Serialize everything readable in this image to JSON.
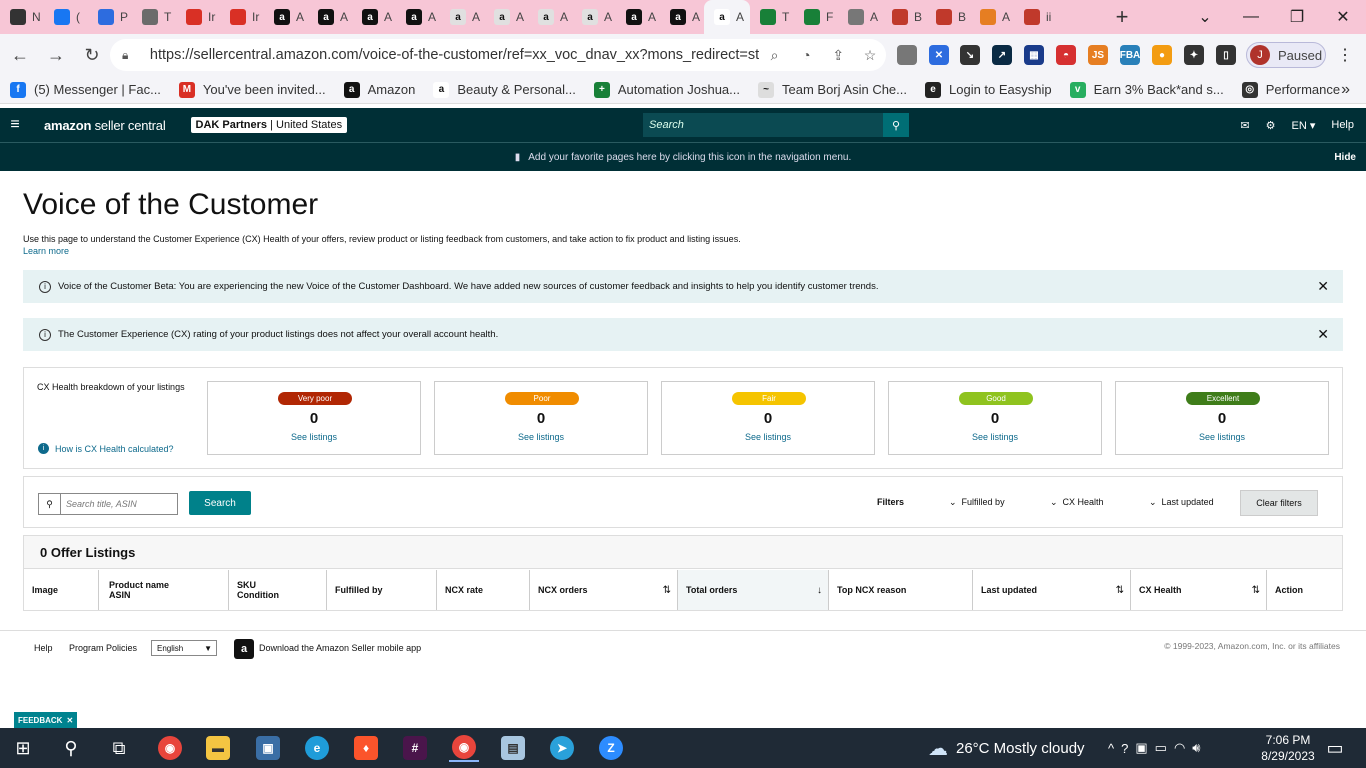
{
  "browser": {
    "tabs": [
      {
        "label": "N",
        "icon": "github-icon",
        "color": "#333333"
      },
      {
        "label": "(",
        "icon": "facebook-icon",
        "color": "#1877f2"
      },
      {
        "label": "P",
        "icon": "zoho-icon",
        "color": "#2d6cdf"
      },
      {
        "label": "T",
        "icon": "t-icon",
        "color": "#6b6b6b"
      },
      {
        "label": "Ir",
        "icon": "gmail-icon",
        "color": "#d93025"
      },
      {
        "label": "Ir",
        "icon": "gmail-icon",
        "color": "#d93025"
      },
      {
        "label": "A",
        "icon": "amazon-icon",
        "color": "#111111"
      },
      {
        "label": "A",
        "icon": "amazon-icon",
        "color": "#111111"
      },
      {
        "label": "A",
        "icon": "amazon-icon",
        "color": "#111111"
      },
      {
        "label": "A",
        "icon": "amazon-icon",
        "color": "#111111"
      },
      {
        "label": "A",
        "icon": "amazon-smile-icon",
        "color": "#e0e0e0"
      },
      {
        "label": "A",
        "icon": "amazon-smile-icon",
        "color": "#e0e0e0"
      },
      {
        "label": "A",
        "icon": "amazon-smile-icon",
        "color": "#e0e0e0"
      },
      {
        "label": "A",
        "icon": "amazon-smile-icon",
        "color": "#e0e0e0"
      },
      {
        "label": "A",
        "icon": "amazon-icon",
        "color": "#111111"
      },
      {
        "label": "A",
        "icon": "amazon-icon",
        "color": "#111111"
      },
      {
        "label": "A",
        "icon": "amazon-seller-icon",
        "color": "#ffffff",
        "active": true
      },
      {
        "label": "T",
        "icon": "sheets-icon",
        "color": "#188038"
      },
      {
        "label": "F",
        "icon": "sheets-icon",
        "color": "#188038"
      },
      {
        "label": "A",
        "icon": "globe-icon",
        "color": "#777777"
      },
      {
        "label": "B",
        "icon": "helium-icon",
        "color": "#c0392b"
      },
      {
        "label": "B",
        "icon": "helium-icon",
        "color": "#c0392b"
      },
      {
        "label": "A",
        "icon": "pencil-icon",
        "color": "#e67e22"
      },
      {
        "label": "ii",
        "icon": "v-icon",
        "color": "#c0392b"
      }
    ],
    "url": "https://sellercentral.amazon.com/voice-of-the-customer/ref=xx_voc_dnav_xx?mons_redirect=stck...",
    "profile_initial": "J",
    "profile_status": "Paused",
    "extensions": [
      {
        "icon": "disk-icon",
        "color": "#777777",
        "text": ""
      },
      {
        "icon": "x-ext-icon",
        "color": "#2d6cdf",
        "text": "✕"
      },
      {
        "icon": "cursor-icon",
        "color": "#333333",
        "text": "↘"
      },
      {
        "icon": "chart-ext-icon",
        "color": "#0a2a44",
        "text": "↗"
      },
      {
        "icon": "grid-ext-icon",
        "color": "#1a3b8a",
        "text": "▦"
      },
      {
        "icon": "pokeball-icon",
        "color": "#d63031",
        "text": "◓"
      },
      {
        "icon": "js-icon",
        "color": "#e67e22",
        "text": "JS"
      },
      {
        "icon": "fba-icon",
        "color": "#2980b9",
        "text": "FBA"
      },
      {
        "icon": "orange-circle-icon",
        "color": "#f39c12",
        "text": "●"
      },
      {
        "icon": "puzzle-icon",
        "color": "#333333",
        "text": "✦"
      },
      {
        "icon": "sidebar-icon",
        "color": "#333333",
        "text": "▯"
      }
    ],
    "bookmarks": [
      {
        "label": "(5) Messenger | Fac...",
        "icon": "facebook-icon",
        "color": "#1877f2",
        "glyph": "f"
      },
      {
        "label": "You've been invited...",
        "icon": "gmail-icon",
        "color": "#d93025",
        "glyph": "M"
      },
      {
        "label": "Amazon",
        "icon": "amazon-icon",
        "color": "#111111",
        "glyph": "a"
      },
      {
        "label": "Beauty & Personal...",
        "icon": "amazon-smile-icon",
        "color": "#ffffff",
        "glyph": "a"
      },
      {
        "label": "Automation Joshua...",
        "icon": "sheets-icon",
        "color": "#188038",
        "glyph": "+"
      },
      {
        "label": "Team Borj Asin Che...",
        "icon": "signature-icon",
        "color": "#dddddd",
        "glyph": "~"
      },
      {
        "label": "Login to Easyship",
        "icon": "easyship-icon",
        "color": "#222222",
        "glyph": "e"
      },
      {
        "label": "Earn 3% Back*and s...",
        "icon": "leaf-icon",
        "color": "#27ae60",
        "glyph": "v"
      },
      {
        "label": "Performance",
        "icon": "globe-icon",
        "color": "#333333",
        "glyph": "◎"
      }
    ]
  },
  "seller_nav": {
    "logo_bold": "amazon",
    "logo_rest": " seller central",
    "account_name": "DAK Partners",
    "account_region": "United States",
    "search_placeholder": "Search",
    "language": "EN",
    "help": "Help",
    "favorites_hint": "Add your favorite pages here by clicking this icon in the navigation menu.",
    "hide": "Hide"
  },
  "main": {
    "title": "Voice of the Customer",
    "description": "Use this page to understand the Customer Experience (CX) Health of your offers, review product or listing feedback from customers, and take action to fix product and listing issues.",
    "learn_more": "Learn more",
    "banners": [
      "Voice of the Customer Beta: You are experiencing the new Voice of the Customer Dashboard. We have added new sources of customer feedback and insights to help you identify customer trends.",
      "The Customer Experience (CX) rating of your product listings does not affect your overall account health."
    ],
    "cx_label": "CX Health breakdown of your listings",
    "cx_how": "How is CX Health calculated?",
    "cx_cards": [
      {
        "label": "Very poor",
        "count": "0",
        "link": "See listings",
        "color": "#b12704"
      },
      {
        "label": "Poor",
        "count": "0",
        "link": "See listings",
        "color": "#f08c00"
      },
      {
        "label": "Fair",
        "count": "0",
        "link": "See listings",
        "color": "#f5c400"
      },
      {
        "label": "Good",
        "count": "0",
        "link": "See listings",
        "color": "#8fc31f"
      },
      {
        "label": "Excellent",
        "count": "0",
        "link": "See listings",
        "color": "#3f7d1a"
      }
    ],
    "search_placeholder": "Search title, ASIN",
    "search_button": "Search",
    "filters_label": "Filters",
    "filter_fulfilled": "Fulfilled by",
    "filter_cx": "CX Health",
    "filter_updated": "Last updated",
    "clear_filters": "Clear filters",
    "listings_title": "0 Offer Listings",
    "columns": {
      "image": "Image",
      "product_1": "Product name",
      "product_2": "ASIN",
      "sku_1": "SKU",
      "sku_2": "Condition",
      "fulfilled": "Fulfilled by",
      "ncx_rate": "NCX rate",
      "ncx_orders": "NCX orders",
      "total_orders": "Total orders",
      "top_reason": "Top NCX reason",
      "last_updated": "Last updated",
      "cx_health": "CX Health",
      "action": "Action"
    }
  },
  "footer": {
    "help": "Help",
    "policies": "Program Policies",
    "language": "English",
    "app_text": "Download the Amazon Seller mobile app",
    "copyright": "© 1999-2023, Amazon.com, Inc. or its affiliates",
    "feedback": "FEEDBACK"
  },
  "taskbar": {
    "weather": "26°C  Mostly cloudy",
    "time": "7:06 PM",
    "date": "8/29/2023"
  }
}
